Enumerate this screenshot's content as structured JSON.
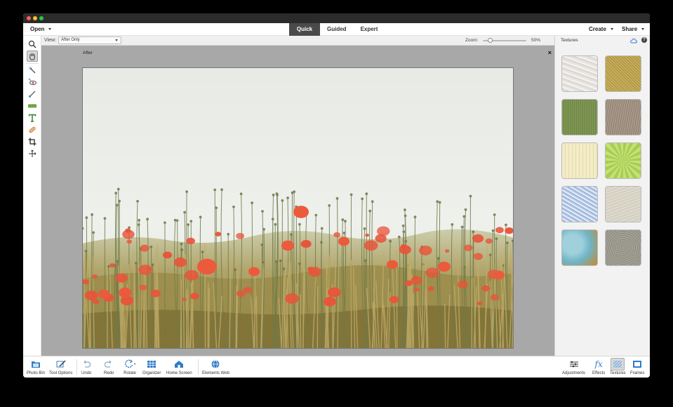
{
  "menubar": {
    "open_label": "Open",
    "modes": [
      "Quick",
      "Guided",
      "Expert"
    ],
    "active_mode": "Quick",
    "create_label": "Create",
    "share_label": "Share"
  },
  "options": {
    "view_label": "View:",
    "view_value": "After Only",
    "zoom_label": "Zoom:",
    "zoom_value": "50%",
    "zoom_level_percent": 50
  },
  "canvas": {
    "after_label": "After",
    "close_glyph": "×"
  },
  "tools": [
    "zoom-icon",
    "hand-icon",
    "quick-selection-icon",
    "red-eye-icon",
    "whiten-teeth-icon",
    "straighten-icon",
    "type-icon",
    "spot-healing-icon",
    "crop-icon",
    "move-icon"
  ],
  "panel": {
    "title": "Textures",
    "help_glyph": "?",
    "textures": [
      {
        "name": "cracked-paint",
        "color": "#e4e1de"
      },
      {
        "name": "gold-weave",
        "color": "#c7ae5c"
      },
      {
        "name": "green-canvas",
        "color": "#7f9653"
      },
      {
        "name": "brown-fabric",
        "color": "#a9998a"
      },
      {
        "name": "cream-stripes",
        "color": "#f3ecc7"
      },
      {
        "name": "green-burst",
        "color": "#a7cd50"
      },
      {
        "name": "blue-marble",
        "color": "#b3c7e4"
      },
      {
        "name": "beige-paper",
        "color": "#dcd8cb"
      },
      {
        "name": "teal-grunge",
        "color": "#6fb4c6"
      },
      {
        "name": "silver-metal",
        "color": "#a3a195"
      }
    ]
  },
  "bottombar": {
    "photo_bin": "Photo Bin",
    "tool_options": "Tool Options",
    "undo": "Undo",
    "redo": "Redo",
    "rotate": "Rotate",
    "organizer": "Organizer",
    "home_screen": "Home Screen",
    "elements_web": "Elements Web",
    "adjustments": "Adjustments",
    "effects": "Effects",
    "effects_glyph": "fx",
    "textures": "Textures",
    "frames": "Frames"
  },
  "colors": {
    "accent_blue": "#2f7cc9",
    "poppy": "#e8543a",
    "sky": "#e9ebe8",
    "wheat": "#b4a265"
  }
}
